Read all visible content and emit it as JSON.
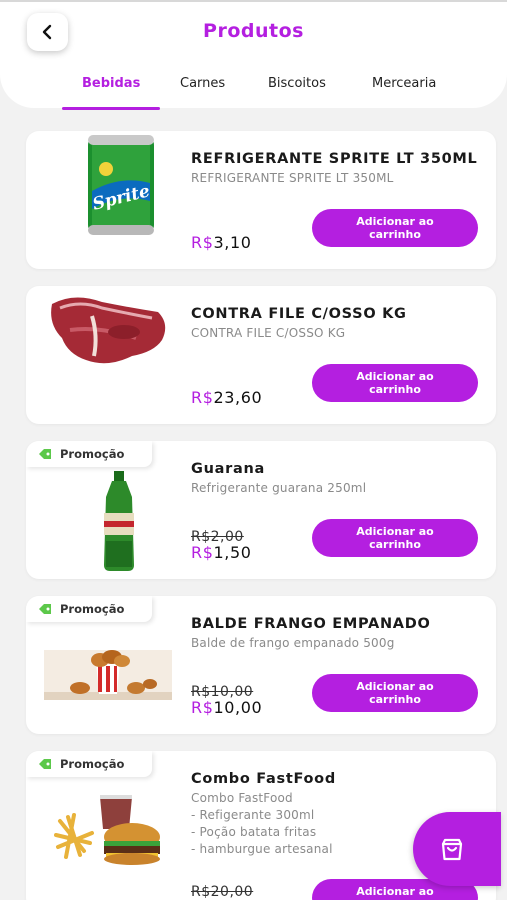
{
  "header": {
    "title": "Produtos"
  },
  "tabs": [
    {
      "label": "Bebidas",
      "active": true
    },
    {
      "label": "Carnes"
    },
    {
      "label": "Biscoitos"
    },
    {
      "label": "Mercearia"
    }
  ],
  "promo_label": "Promoção",
  "add_button_label": "Adicionar ao carrinho",
  "currency_symbol": "R$",
  "products": [
    {
      "name": "REFRIGERANTE SPRITE LT 350ML",
      "description": "REFRIGERANTE SPRITE LT 350ML",
      "price": "3,10",
      "image": "sprite-can"
    },
    {
      "name": "CONTRA FILE C/OSSO KG",
      "description": "CONTRA FILE C/OSSO KG",
      "price": "23,60",
      "image": "steak"
    },
    {
      "name": "Guarana",
      "description": "Refrigerante guarana 250ml",
      "old_price": "R$2,00",
      "price": "1,50",
      "promo": true,
      "image": "guarana-bottle"
    },
    {
      "name": "BALDE FRANGO EMPANADO",
      "description": "Balde de frango empanado 500g",
      "old_price": "R$10,00",
      "price": "10,00",
      "promo": true,
      "image": "chicken-bucket"
    },
    {
      "name": "Combo FastFood",
      "description_lines": [
        "Combo FastFood",
        "- Refigerante 300ml",
        "- Poção batata fritas",
        "- hamburgue artesanal"
      ],
      "old_price": "R$20,00",
      "promo": true,
      "image": "burger-combo"
    }
  ],
  "colors": {
    "accent": "#b41fe0",
    "background": "#f2f2f2",
    "card": "#ffffff"
  },
  "icons": {
    "back": "chevron-left-icon",
    "promo": "tag-icon",
    "cart": "shopping-bag-icon"
  }
}
